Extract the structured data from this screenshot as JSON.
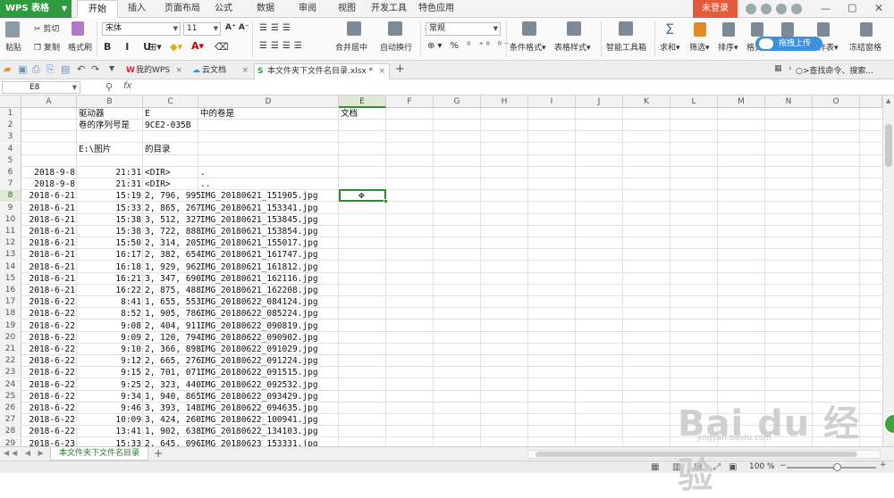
{
  "app": {
    "name": "WPS 表格"
  },
  "menu_tabs": [
    "开始",
    "插入",
    "页面布局",
    "公式",
    "数据",
    "审阅",
    "视图",
    "开发工具",
    "特色应用"
  ],
  "active_menu_tab": "开始",
  "login_label": "未登录",
  "upload_label": "拖拽上传",
  "ribbon": {
    "paste": "粘贴",
    "cut": "剪切",
    "copy": "复制",
    "format_painter": "格式刷",
    "font_name": "宋体",
    "font_size": "11",
    "merge_center": "合并居中",
    "wrap": "自动换行",
    "number_format": "常规",
    "cond_format": "条件格式",
    "table_style": "表格样式",
    "smart_toolbox": "智能工具箱",
    "sum": "求和",
    "filter": "筛选",
    "sort": "排序",
    "format": "格式",
    "row_col": "行和列",
    "worksheet": "工作表",
    "freeze": "冻结窗格"
  },
  "doc_tabs": [
    {
      "label": "我的WPS"
    },
    {
      "label": "云文档"
    },
    {
      "label": "本文件夹下文件名目录.xlsx *"
    }
  ],
  "search_label": ">查找命令、搜索...",
  "formula_bar": {
    "name_box": "E8",
    "fx": "fx"
  },
  "columns": [
    "A",
    "B",
    "C",
    "D",
    "E",
    "F",
    "G",
    "H",
    "I",
    "J",
    "K",
    "L",
    "M",
    "N",
    "O"
  ],
  "selected_column": "E",
  "selected_row": "8",
  "rows": [
    {
      "n": "1",
      "a": "",
      "b": "驱动器",
      "c": "E",
      "d": "中的卷是",
      "e": "文档"
    },
    {
      "n": "2",
      "a": "",
      "b": "卷的序列号是",
      "c": "9CE2-035B",
      "d": "",
      "e": ""
    },
    {
      "n": "3",
      "a": "",
      "b": "",
      "c": "",
      "d": "",
      "e": ""
    },
    {
      "n": "4",
      "a": "",
      "b": "E:\\图片",
      "c": "的目录",
      "d": "",
      "e": ""
    },
    {
      "n": "5",
      "a": "",
      "b": "",
      "c": "",
      "d": "",
      "e": ""
    },
    {
      "n": "6",
      "a": "2018-9-8",
      "b": "21:31",
      "c": "<DIR>",
      "d": ".",
      "e": ""
    },
    {
      "n": "7",
      "a": "2018-9-8",
      "b": "21:31",
      "c": "<DIR>",
      "d": "..",
      "e": ""
    },
    {
      "n": "8",
      "a": "2018-6-21",
      "b": "15:19",
      "c": "2, 796, 995",
      "d": "IMG_20180621_151905.jpg",
      "e": ""
    },
    {
      "n": "9",
      "a": "2018-6-21",
      "b": "15:33",
      "c": "2, 865, 267",
      "d": "IMG_20180621_153341.jpg",
      "e": ""
    },
    {
      "n": "10",
      "a": "2018-6-21",
      "b": "15:38",
      "c": "3, 512, 327",
      "d": "IMG_20180621_153845.jpg",
      "e": ""
    },
    {
      "n": "11",
      "a": "2018-6-21",
      "b": "15:38",
      "c": "3, 722, 888",
      "d": "IMG_20180621_153854.jpg",
      "e": ""
    },
    {
      "n": "12",
      "a": "2018-6-21",
      "b": "15:50",
      "c": "2, 314, 205",
      "d": "IMG_20180621_155017.jpg",
      "e": ""
    },
    {
      "n": "13",
      "a": "2018-6-21",
      "b": "16:17",
      "c": "2, 382, 654",
      "d": "IMG_20180621_161747.jpg",
      "e": ""
    },
    {
      "n": "14",
      "a": "2018-6-21",
      "b": "16:18",
      "c": "1, 929, 962",
      "d": "IMG_20180621_161812.jpg",
      "e": ""
    },
    {
      "n": "15",
      "a": "2018-6-21",
      "b": "16:21",
      "c": "3, 347, 690",
      "d": "IMG_20180621_162116.jpg",
      "e": ""
    },
    {
      "n": "16",
      "a": "2018-6-21",
      "b": "16:22",
      "c": "2, 875, 488",
      "d": "IMG_20180621_162208.jpg",
      "e": ""
    },
    {
      "n": "17",
      "a": "2018-6-22",
      "b": "8:41",
      "c": "1, 655, 553",
      "d": "IMG_20180622_084124.jpg",
      "e": ""
    },
    {
      "n": "18",
      "a": "2018-6-22",
      "b": "8:52",
      "c": "1, 905, 786",
      "d": "IMG_20180622_085224.jpg",
      "e": ""
    },
    {
      "n": "19",
      "a": "2018-6-22",
      "b": "9:08",
      "c": "2, 404, 911",
      "d": "IMG_20180622_090819.jpg",
      "e": ""
    },
    {
      "n": "20",
      "a": "2018-6-22",
      "b": "9:09",
      "c": "2, 120, 794",
      "d": "IMG_20180622_090902.jpg",
      "e": ""
    },
    {
      "n": "21",
      "a": "2018-6-22",
      "b": "9:10",
      "c": "2, 366, 898",
      "d": "IMG_20180622_091029.jpg",
      "e": ""
    },
    {
      "n": "22",
      "a": "2018-6-22",
      "b": "9:12",
      "c": "2, 665, 276",
      "d": "IMG_20180622_091224.jpg",
      "e": ""
    },
    {
      "n": "23",
      "a": "2018-6-22",
      "b": "9:15",
      "c": "2, 701, 071",
      "d": "IMG_20180622_091515.jpg",
      "e": ""
    },
    {
      "n": "24",
      "a": "2018-6-22",
      "b": "9:25",
      "c": "2, 323, 440",
      "d": "IMG_20180622_092532.jpg",
      "e": ""
    },
    {
      "n": "25",
      "a": "2018-6-22",
      "b": "9:34",
      "c": "1, 940, 865",
      "d": "IMG_20180622_093429.jpg",
      "e": ""
    },
    {
      "n": "26",
      "a": "2018-6-22",
      "b": "9:46",
      "c": "3, 393, 148",
      "d": "IMG_20180622_094635.jpg",
      "e": ""
    },
    {
      "n": "27",
      "a": "2018-6-22",
      "b": "10:09",
      "c": "3, 424, 260",
      "d": "IMG_20180622_100941.jpg",
      "e": ""
    },
    {
      "n": "28",
      "a": "2018-6-22",
      "b": "13:41",
      "c": "1, 902, 638",
      "d": "IMG_20180622_134103.jpg",
      "e": ""
    },
    {
      "n": "29",
      "a": "2018-6-23",
      "b": "15:33",
      "c": "2, 645, 096",
      "d": "IMG_20180623_153331.jpg",
      "e": ""
    }
  ],
  "sheet_tab": "本文件夹下文件名目录",
  "zoom": "100 %",
  "watermark": {
    "main": "Bai du 经验",
    "sub": "jingyan.baidu.com"
  },
  "colors": {
    "accent_green": "#2e9b3f",
    "login_red": "#e35b3a",
    "upload_blue": "#3d8fe0"
  }
}
